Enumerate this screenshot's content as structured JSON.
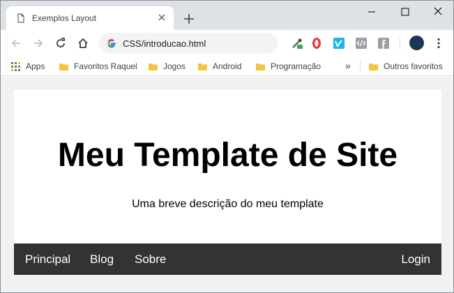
{
  "browser": {
    "tab": {
      "title": "Exemplos Layout"
    },
    "address_bar": {
      "url": "CSS/introducao.html"
    },
    "bookmarks": [
      {
        "label": "Apps",
        "icon": "apps-grid-icon"
      },
      {
        "label": "Favoritos Raquel",
        "icon": "folder-icon"
      },
      {
        "label": "Jogos",
        "icon": "folder-icon"
      },
      {
        "label": "Android",
        "icon": "folder-icon"
      },
      {
        "label": "Programação",
        "icon": "folder-icon"
      },
      {
        "label": "Outros favoritos",
        "icon": "folder-icon"
      }
    ],
    "overflow_label": "»"
  },
  "page": {
    "title": "Meu Template de Site",
    "description": "Uma breve descrição do meu template",
    "nav": {
      "items": [
        {
          "label": "Principal"
        },
        {
          "label": "Blog"
        },
        {
          "label": "Sobre"
        }
      ],
      "login": "Login"
    }
  },
  "colors": {
    "page_background": "#f1f1f1",
    "header_background": "#ffffff",
    "navbar_background": "#333333",
    "navbar_text": "#ffffff",
    "chrome_frame": "#dee1e6"
  }
}
